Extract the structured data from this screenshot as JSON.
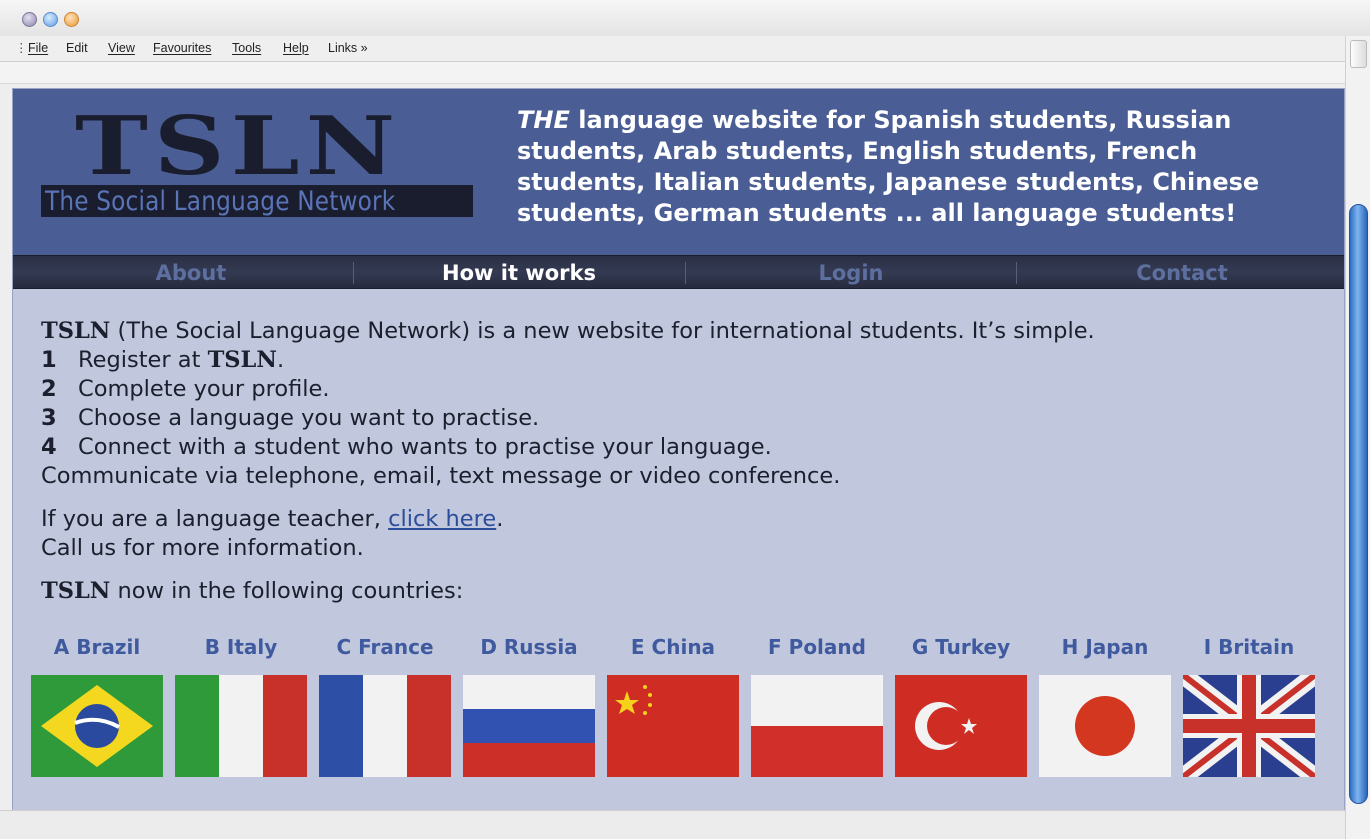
{
  "menu": {
    "file": "File",
    "edit": "Edit",
    "view": "View",
    "favourites": "Favourites",
    "tools": "Tools",
    "help": "Help",
    "links": "Links »"
  },
  "header": {
    "logo_letters": "TSLN",
    "logo_subtitle": "The Social Language Network",
    "tagline_em": "THE",
    "tagline_rest": " language website for Spanish students, Russian students, Arab students, English students, French students, Italian students, Japanese students, Chinese students, German students ... all language students!"
  },
  "nav": {
    "items": [
      {
        "label": "About"
      },
      {
        "label": "How it works"
      },
      {
        "label": "Login"
      },
      {
        "label": "Contact"
      }
    ],
    "active": "How it works"
  },
  "content": {
    "intro_brand": "TSLN",
    "intro_text": " (The Social Language Network) is a new website for international students. It’s simple.",
    "steps": [
      {
        "num": "1",
        "text": "Register at ",
        "brand": "TSLN",
        "after": "."
      },
      {
        "num": "2",
        "text": "Complete your profile."
      },
      {
        "num": "3",
        "text": "Choose a language you want to practise."
      },
      {
        "num": "4",
        "text": "Connect with a student who wants to practise your language."
      }
    ],
    "communicate": "Communicate via telephone, email, text message or video conference.",
    "teacher_before": "If you are a language teacher, ",
    "teacher_link": "click here",
    "teacher_after": ".",
    "call": "Call us for more information.",
    "countries_brand": "TSLN",
    "countries_text": " now in the following countries:"
  },
  "countries": [
    {
      "label": "A Brazil",
      "flag": "brazil-flag"
    },
    {
      "label": "B Italy",
      "flag": "italy-flag"
    },
    {
      "label": "C France",
      "flag": "france-flag"
    },
    {
      "label": "D Russia",
      "flag": "russia-flag"
    },
    {
      "label": "E China",
      "flag": "china-flag"
    },
    {
      "label": "F Poland",
      "flag": "poland-flag"
    },
    {
      "label": "G Turkey",
      "flag": "turkey-flag"
    },
    {
      "label": "H Japan",
      "flag": "japan-flag"
    },
    {
      "label": "I Britain",
      "flag": "britain-flag"
    }
  ],
  "colors": {
    "header_bg": "#4a5e95",
    "page_bg": "#c1c8dd",
    "nav_bg": "#2f344a",
    "country_label": "#3f5a9e",
    "link": "#2b4d9b"
  }
}
